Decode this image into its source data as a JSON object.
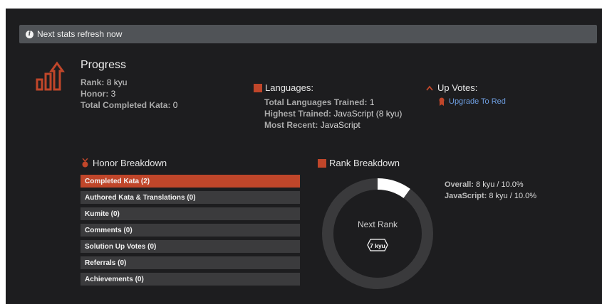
{
  "notice": {
    "text": "Next stats refresh now"
  },
  "progress": {
    "title": "Progress",
    "rank_label": "Rank:",
    "rank_value": "8 kyu",
    "honor_label": "Honor:",
    "honor_value": "3",
    "completed_label": "Total Completed Kata:",
    "completed_value": "0"
  },
  "languages": {
    "title": "Languages:",
    "trained_label": "Total Languages Trained:",
    "trained_value": "1",
    "highest_label": "Highest Trained:",
    "highest_value": "JavaScript (8 kyu)",
    "recent_label": "Most Recent:",
    "recent_value": "JavaScript"
  },
  "upvotes": {
    "title": "Up Votes:",
    "link": "Upgrade To Red"
  },
  "honor_breakdown": {
    "title": "Honor Breakdown",
    "items": [
      "Completed Kata (2)",
      "Authored Kata & Translations (0)",
      "Kumite (0)",
      "Comments (0)",
      "Solution Up Votes (0)",
      "Referrals (0)",
      "Achievements (0)"
    ]
  },
  "rank_breakdown": {
    "title": "Rank Breakdown",
    "center_label": "Next Rank",
    "next_rank": "7 kyu",
    "progress_fraction": 0.1,
    "overall_label": "Overall:",
    "overall_value": "8 kyu / 10.0%",
    "js_label": "JavaScript:",
    "js_value": "8 kyu / 10.0%"
  },
  "colors": {
    "accent": "#c0462a",
    "link": "#6e9ee0",
    "ring_track": "#3a3a3c",
    "ring_fill": "#ffffff"
  }
}
